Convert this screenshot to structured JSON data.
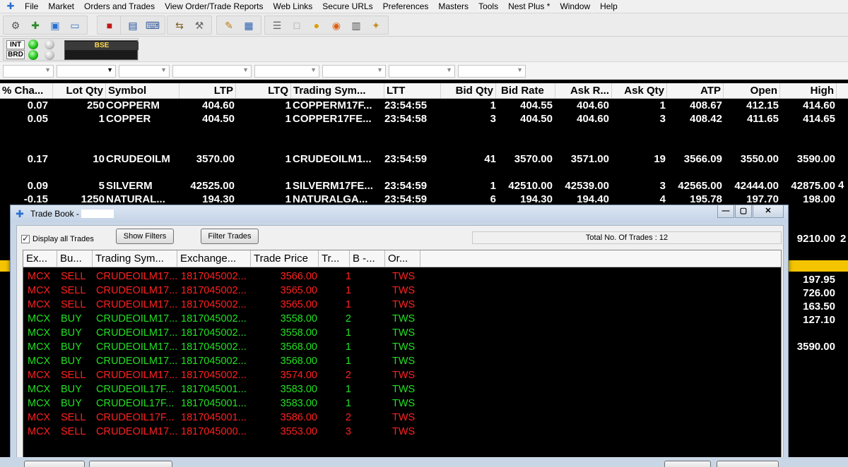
{
  "menu": [
    "File",
    "Market",
    "Orders and Trades",
    "View Order/Trade Reports",
    "Web Links",
    "Secure URLs",
    "Preferences",
    "Masters",
    "Tools",
    "Nest Plus *",
    "Window",
    "Help"
  ],
  "status": {
    "int_label": "INT",
    "brd_label": "BRD",
    "exchange_label": "BSE"
  },
  "market_watch": {
    "columns": [
      "% Cha...",
      "Lot Qty",
      "Symbol",
      "LTP",
      "LTQ",
      "Trading Sym...",
      "LTT",
      "Bid Qty",
      "Bid Rate",
      "Ask R...",
      "Ask Qty",
      "ATP",
      "Open",
      "High"
    ],
    "rows": [
      [
        "0.07",
        "250",
        "COPPERM",
        "404.60",
        "1",
        "COPPERM17F...",
        "23:54:55",
        "1",
        "404.55",
        "404.60",
        "1",
        "408.67",
        "412.15",
        "414.60"
      ],
      [
        "0.05",
        "1",
        "COPPER",
        "404.50",
        "1",
        "COPPER17FE...",
        "23:54:58",
        "3",
        "404.50",
        "404.60",
        "3",
        "408.42",
        "411.65",
        "414.65"
      ],
      [
        "0.17",
        "10",
        "CRUDEOILM",
        "3570.00",
        "1",
        "CRUDEOILM1...",
        "23:54:59",
        "41",
        "3570.00",
        "3571.00",
        "19",
        "3566.09",
        "3550.00",
        "3590.00"
      ],
      [
        "0.09",
        "5",
        "SILVERM",
        "42525.00",
        "1",
        "SILVERM17FE...",
        "23:54:59",
        "1",
        "42510.00",
        "42539.00",
        "3",
        "42565.00",
        "42444.00",
        "42875.00"
      ],
      [
        "-0.15",
        "1250",
        "NATURAL...",
        "194.30",
        "1",
        "NATURALGA...",
        "23:54:59",
        "6",
        "194.30",
        "194.40",
        "4",
        "195.78",
        "197.70",
        "198.00"
      ]
    ],
    "right_partial": [
      "9210.00",
      "197.95",
      "726.00",
      "163.50",
      "127.10",
      "3590.00"
    ],
    "right_strip": [
      "4",
      "2"
    ]
  },
  "trade_book": {
    "title": "Trade Book -",
    "display_all_label": "Display all Trades",
    "show_filters_label": "Show Filters",
    "filter_trades_label": "Filter Trades",
    "total_trades_label": "Total No. Of Trades : 12",
    "columns": [
      "Ex...",
      "Bu...",
      "Trading Sym...",
      "Exchange...",
      "Trade Price",
      "Tr...",
      "B -...",
      "Or..."
    ],
    "rows": [
      {
        "ex": "MCX",
        "side": "SELL",
        "sym": "CRUDEOILM17...",
        "exch": "1817045002...",
        "price": "3566.00",
        "qty": "1",
        "order": "TWS",
        "color": "#ff2020"
      },
      {
        "ex": "MCX",
        "side": "SELL",
        "sym": "CRUDEOILM17...",
        "exch": "1817045002...",
        "price": "3565.00",
        "qty": "1",
        "order": "TWS",
        "color": "#ff2020"
      },
      {
        "ex": "MCX",
        "side": "SELL",
        "sym": "CRUDEOILM17...",
        "exch": "1817045002...",
        "price": "3565.00",
        "qty": "1",
        "order": "TWS",
        "color": "#ff2020"
      },
      {
        "ex": "MCX",
        "side": "BUY",
        "sym": "CRUDEOILM17...",
        "exch": "1817045002...",
        "price": "3558.00",
        "qty": "2",
        "order": "TWS",
        "color": "#22e022"
      },
      {
        "ex": "MCX",
        "side": "BUY",
        "sym": "CRUDEOILM17...",
        "exch": "1817045002...",
        "price": "3558.00",
        "qty": "1",
        "order": "TWS",
        "color": "#22e022"
      },
      {
        "ex": "MCX",
        "side": "BUY",
        "sym": "CRUDEOILM17...",
        "exch": "1817045002...",
        "price": "3568.00",
        "qty": "1",
        "order": "TWS",
        "color": "#22e022"
      },
      {
        "ex": "MCX",
        "side": "BUY",
        "sym": "CRUDEOILM17...",
        "exch": "1817045002...",
        "price": "3568.00",
        "qty": "1",
        "order": "TWS",
        "color": "#22e022"
      },
      {
        "ex": "MCX",
        "side": "SELL",
        "sym": "CRUDEOILM17...",
        "exch": "1817045002...",
        "price": "3574.00",
        "qty": "2",
        "order": "TWS",
        "color": "#ff2020"
      },
      {
        "ex": "MCX",
        "side": "BUY",
        "sym": "CRUDEOIL17F...",
        "exch": "1817045001...",
        "price": "3583.00",
        "qty": "1",
        "order": "TWS",
        "color": "#22e022"
      },
      {
        "ex": "MCX",
        "side": "BUY",
        "sym": "CRUDEOIL17F...",
        "exch": "1817045001...",
        "price": "3583.00",
        "qty": "1",
        "order": "TWS",
        "color": "#22e022"
      },
      {
        "ex": "MCX",
        "side": "SELL",
        "sym": "CRUDEOIL17F...",
        "exch": "1817045001...",
        "price": "3586.00",
        "qty": "2",
        "order": "TWS",
        "color": "#ff2020"
      },
      {
        "ex": "MCX",
        "side": "SELL",
        "sym": "CRUDEOILM17...",
        "exch": "1817045000...",
        "price": "3553.00",
        "qty": "3",
        "order": "TWS",
        "color": "#ff2020"
      }
    ]
  },
  "toolbar_icons": [
    "connect-icon",
    "add-icon",
    "market-picture-icon",
    "screen-icon",
    "order-book-icon",
    "trade-icon",
    "keyboard-icon",
    "transfer-icon",
    "settings-icon",
    "notepad-icon",
    "reports-icon",
    "list-icon",
    "blank-icon",
    "coins-icon",
    "rss-icon",
    "calculator-icon",
    "tools-icon"
  ]
}
